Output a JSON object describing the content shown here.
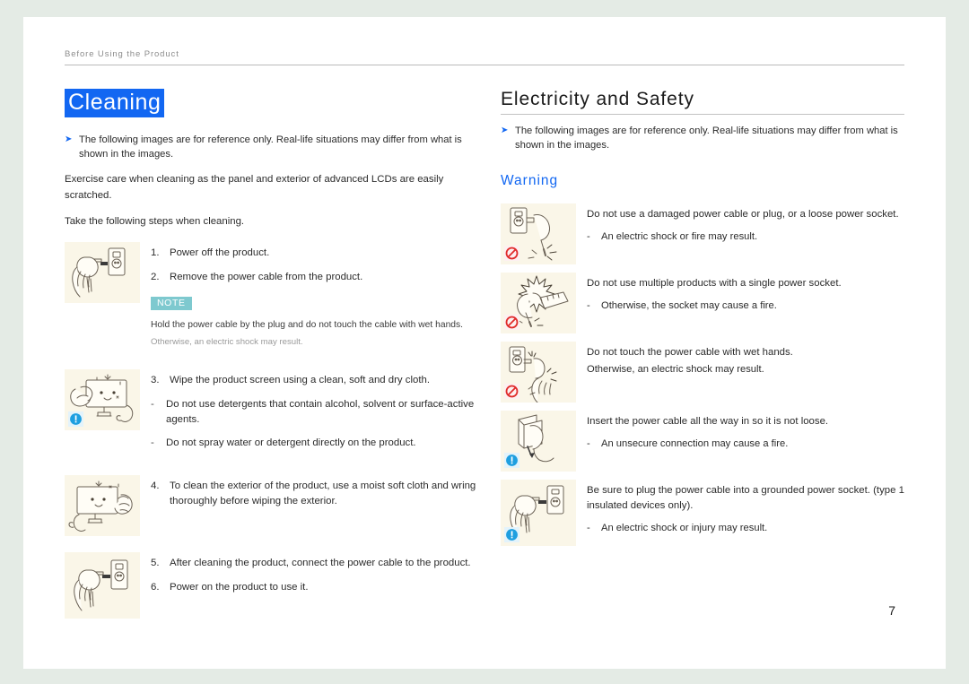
{
  "header": {
    "running_title": "Before Using the Product"
  },
  "page_number": "7",
  "colors": {
    "highlight_blue": "#1267f2",
    "heading_blue": "#1267f2",
    "note_teal": "#7ec9cf",
    "illustration_bg": "#faf6e8",
    "page_bg": "#e4ebe5",
    "sheet_bg": "#ffffff"
  },
  "left_column": {
    "title": "Cleaning",
    "reference_note": "The following images are for reference only. Real-life situations may differ from what is shown in the images.",
    "paragraphs": [
      "Exercise care when cleaning as the panel and exterior of advanced LCDs are easily scratched.",
      "Take the following steps when cleaning."
    ],
    "groups": [
      {
        "illustration": "hand-unplugging-power-cable-from-wall-socket",
        "badge": null,
        "steps": [
          {
            "num": "1.",
            "text": "Power off the product."
          },
          {
            "num": "2.",
            "text": "Remove the power cable from the product."
          }
        ],
        "note": {
          "badge": "NOTE",
          "line1": "Hold the power cable by the plug and do not touch the cable with wet hands.",
          "line2": "Otherwise, an electric shock may result."
        }
      },
      {
        "illustration": "hand-wiping-monitor-screen-with-cloth",
        "badge": "info",
        "steps": [
          {
            "num": "3.",
            "text": "Wipe the product screen using a clean, soft and dry cloth."
          }
        ],
        "dashes": [
          "Do not use detergents that contain alcohol, solvent or surface-active agents.",
          "Do not spray water or detergent directly on the product."
        ]
      },
      {
        "illustration": "hand-wiping-monitor-exterior-with-moist-cloth",
        "badge": null,
        "steps": [
          {
            "num": "4.",
            "text": "To clean the exterior of the product, use a moist soft cloth and wring thoroughly before wiping the exterior."
          }
        ]
      },
      {
        "illustration": "hand-plugging-power-cable-into-wall-socket",
        "badge": null,
        "steps": [
          {
            "num": "5.",
            "text": "After cleaning the product, connect the power cable to the product."
          },
          {
            "num": "6.",
            "text": "Power on the product to use it."
          }
        ]
      }
    ]
  },
  "right_column": {
    "title": "Electricity and Safety",
    "reference_note": "The following images are for reference only. Real-life situations may differ from what is shown in the images.",
    "subheading": "Warning",
    "items": [
      {
        "illustration": "damaged-power-cable-and-plug",
        "badge": "ban",
        "title": "Do not use a damaged power cable or plug, or a loose power socket.",
        "subs": [
          "An electric shock or fire may result."
        ],
        "plain": []
      },
      {
        "illustration": "multiple-plugs-in-single-power-strip-sparking",
        "badge": "ban",
        "title": "Do not use multiple products with a single power socket.",
        "subs": [
          "Otherwise, the socket may cause a fire."
        ],
        "plain": []
      },
      {
        "illustration": "wet-hand-touching-power-cable-at-socket",
        "badge": "ban",
        "title": "Do not touch the power cable with wet hands.",
        "subs": [],
        "plain": [
          "Otherwise, an electric shock may result."
        ]
      },
      {
        "illustration": "plug-inserted-fully-into-socket",
        "badge": "info",
        "title": "Insert the power cable all the way in so it is not loose.",
        "subs": [
          "An unsecure connection may cause a fire."
        ],
        "plain": []
      },
      {
        "illustration": "hand-plugging-cable-into-grounded-socket",
        "badge": "info",
        "title": "Be sure to plug the power cable into a grounded power socket. (type 1 insulated devices only).",
        "subs": [
          "An electric shock or injury may result."
        ],
        "plain": []
      }
    ]
  },
  "icons": {
    "reference_arrow": "double-chevron-right-icon",
    "ban": "prohibition-circle-slash-icon",
    "info": "exclamation-info-icon"
  }
}
